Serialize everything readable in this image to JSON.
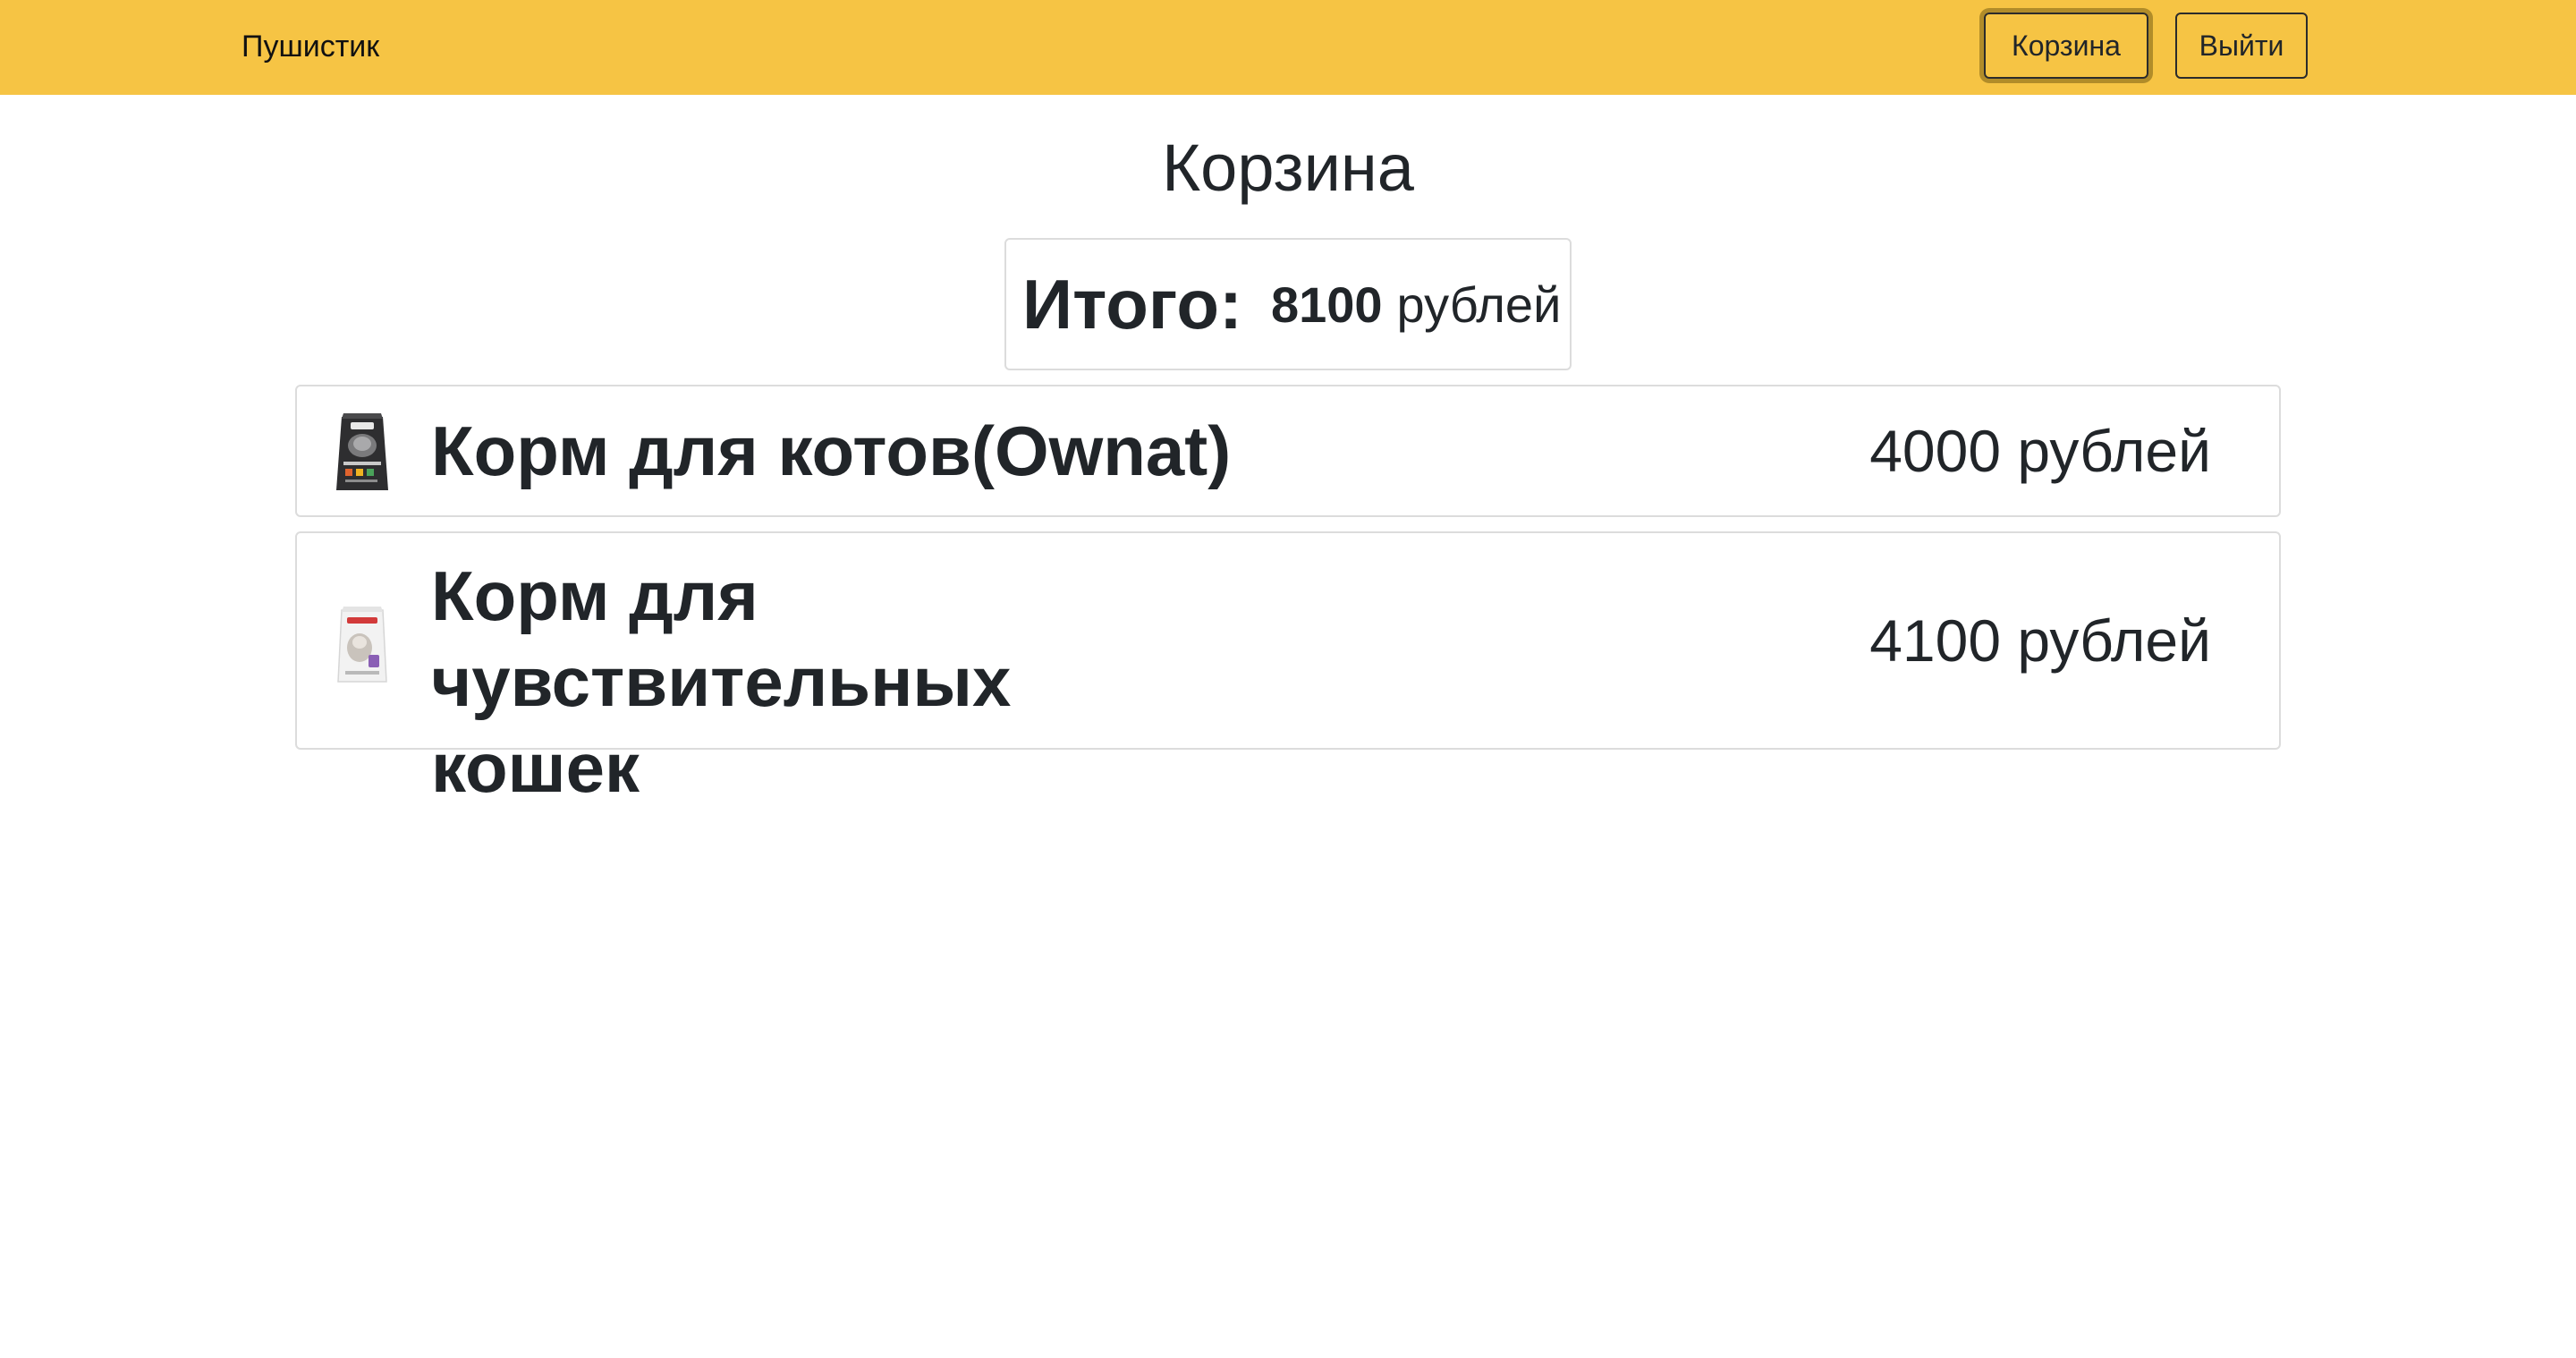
{
  "navbar": {
    "brand": "Пушистик",
    "cart_button": "Корзина",
    "logout_button": "Выйти",
    "background_color": "#f6c444"
  },
  "page": {
    "title": "Корзина"
  },
  "total": {
    "label": "Итого:",
    "value": "8100",
    "currency": "рублей"
  },
  "items": [
    {
      "name": "Корм для котов(Ownat)",
      "price": "4000 рублей",
      "image": "dark-food-bag-thumbnail"
    },
    {
      "name": "Корм для чувствительных кошек",
      "price": "4100 рублей",
      "image": "white-food-bag-thumbnail"
    }
  ]
}
